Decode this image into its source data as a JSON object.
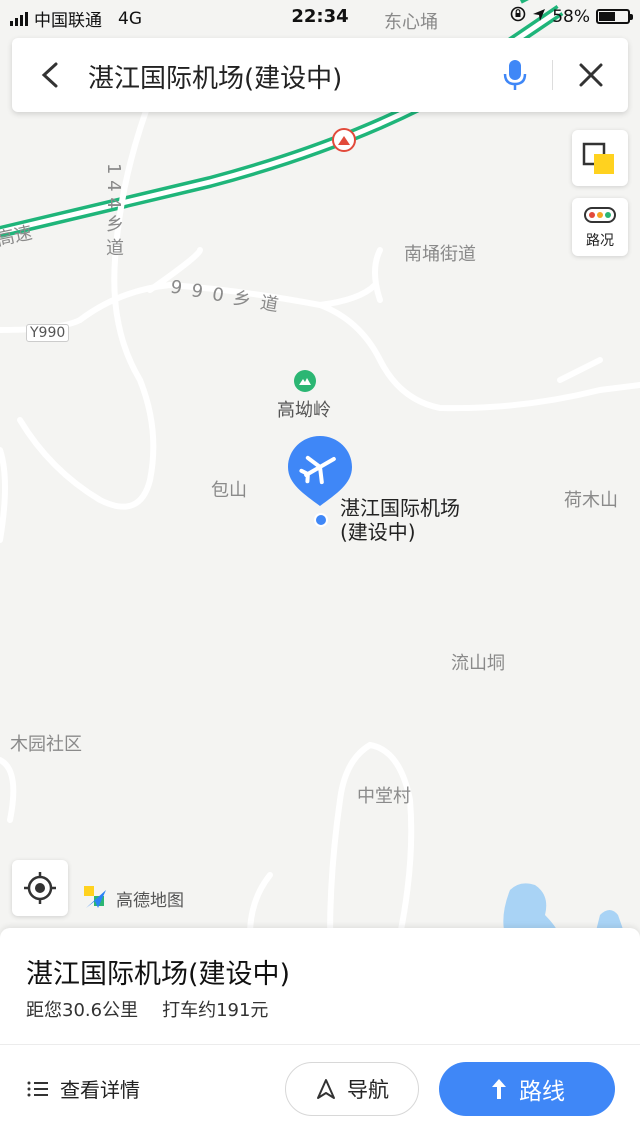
{
  "status_bar": {
    "carrier": "中国联通",
    "network": "4G",
    "time": "22:34",
    "battery": "58%",
    "battery_level": 0.58
  },
  "search": {
    "title": "湛江国际机场(建设中)"
  },
  "map_controls": {
    "traffic_label": "路况",
    "brand": "高德地图"
  },
  "map_labels": {
    "dongxin": "东心埇",
    "road_144": "1 4 4 乡 道",
    "expressway": "高速",
    "nanyong": "南埇街道",
    "road_990": "9 9 0 乡 道",
    "y990": "Y990",
    "gaoyouling": "高坳岭",
    "baoshan": "包山",
    "airport_line1": "湛江国际机场",
    "airport_line2": "(建设中)",
    "hemushan": "荷木山",
    "liushandong": "流山垌",
    "muyuan": "木园社区",
    "zhongtang": "中堂村"
  },
  "place": {
    "name": "湛江国际机场(建设中)",
    "distance": "距您30.6公里",
    "taxi": "打车约191元"
  },
  "actions": {
    "details": "查看详情",
    "navigate": "导航",
    "route": "路线"
  },
  "colors": {
    "accent": "#3f87f7",
    "expressway": "#1fb57a",
    "poi_green": "#2bb673"
  }
}
